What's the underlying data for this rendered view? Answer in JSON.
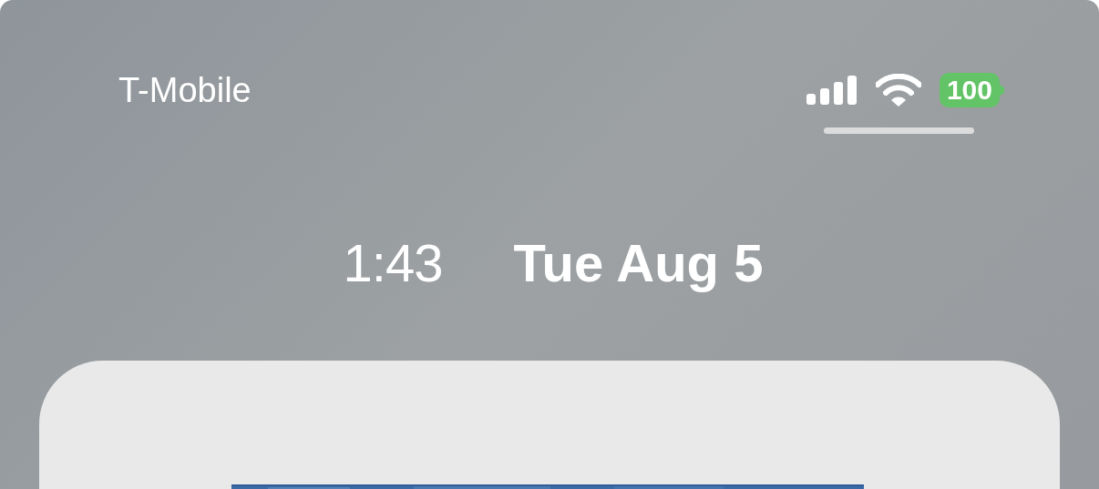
{
  "status_bar": {
    "carrier": "T-Mobile",
    "battery": "100"
  },
  "lock_header": {
    "time": "1:43",
    "date": "Tue Aug 5"
  }
}
